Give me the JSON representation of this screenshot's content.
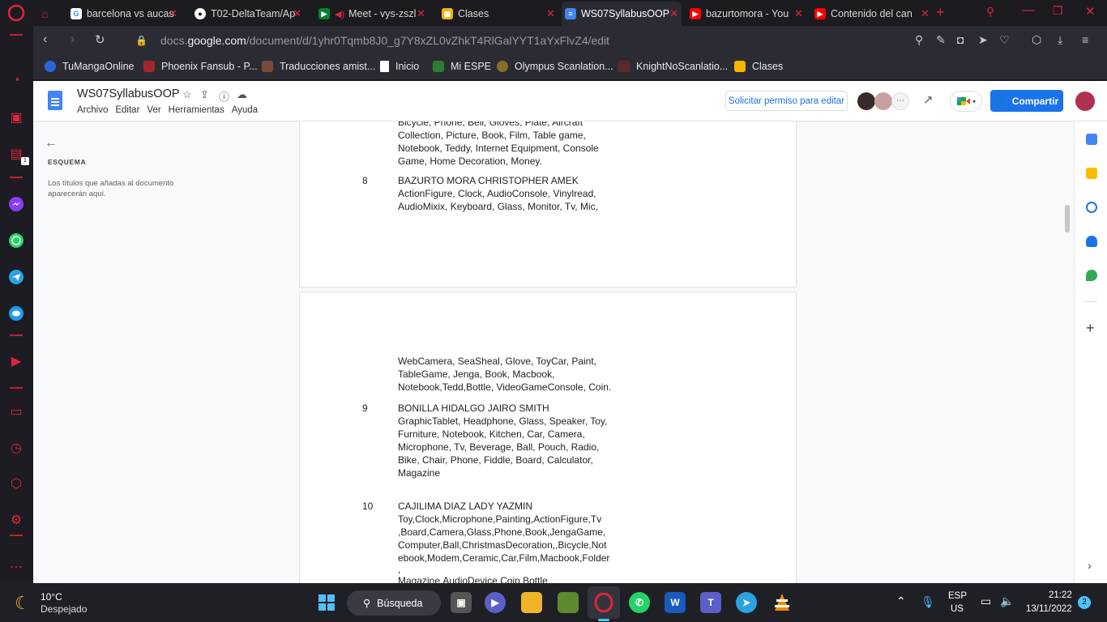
{
  "browser": {
    "tabs": [
      {
        "label": "barcelona vs aucas",
        "icon": "google-icon"
      },
      {
        "label": "T02-DeltaTeam/Ap",
        "icon": "github-icon"
      },
      {
        "label": "Meet - vys-zszl",
        "icon": "google-meet-icon"
      },
      {
        "label": "Clases",
        "icon": "classroom-icon"
      },
      {
        "label": "WS07SyllabusOOP",
        "icon": "google-docs-icon",
        "active": true
      },
      {
        "label": "bazurtomora - You",
        "icon": "youtube-icon"
      },
      {
        "label": "Contenido del can",
        "icon": "youtube-icon"
      }
    ],
    "url_prefix": "docs.",
    "url_domain": "google.com",
    "url_path": "/document/d/1yhr0Tqmb8J0_g7Y8xZL0vZhkT4RlGalYYT1aYxFlvZ4/edit",
    "bookmarks": [
      {
        "label": "TuMangaOnline"
      },
      {
        "label": "Phoenix Fansub - P..."
      },
      {
        "label": "Traducciones amist..."
      },
      {
        "label": "Inicio"
      },
      {
        "label": "Mi ESPE"
      },
      {
        "label": "Olympus Scanlation..."
      },
      {
        "label": "KnightNoScanlatio..."
      },
      {
        "label": "Clases"
      }
    ]
  },
  "docs": {
    "title": "WS07SyllabusOOP",
    "menu": [
      "Archivo",
      "Editar",
      "Ver",
      "Herramientas",
      "Ayuda"
    ],
    "request_edit_label": "Solicitar permiso para editar",
    "share_label": "Compartir"
  },
  "outline": {
    "title": "ESQUEMA",
    "hint": "Los títulos que añadas al documento aparecerán aquí."
  },
  "document": {
    "page1_top_text": "Bicycle, Phone, Bell, Gloves, Plate, Aircraft Collection, Picture, Book, Film, Table game, Notebook, Teddy, Internet Equipment, Console Game, Home Decoration, Money.",
    "entry8": {
      "num": "8",
      "name": "BAZURTO MORA CHRISTOPHER AMEK",
      "items": "ActionFigure, Clock, AudioConsole, Vinylread, AudioMixix, Keyboard, Glass, Monitor, Tv, Mic,"
    },
    "page2_continuation": "WebCamera, SeaSheal, Glove, ToyCar, Paint, TableGame, Jenga, Book, Macbook, Notebook,Tedd,Bottle, VideoGameConsole, Coin.",
    "entry9": {
      "num": "9",
      "name": "BONILLA HIDALGO JAIRO SMITH",
      "items": "GraphicTablet, Headphone, Glass, Speaker, Toy, Furniture, Notebook, Kitchen, Car, Camera, Microphone, Tv, Beverage, Ball, Pouch, Radio, Bike, Chair, Phone, Fiddle, Board, Calculator, Magazine"
    },
    "entry10": {
      "num": "10",
      "name": "CAJILIMA DIAZ LADY YAZMIN",
      "items_line1": "Toy,Clock,Microphone,Painting,ActionFigure,Tv",
      "items_line2": ",Board,Camera,Glass,Phone,Book,JengaGame,",
      "items_line3": "Computer,Ball,ChristmasDecoration,,Bicycle,Not",
      "items_line4": "ebook,Modem,Ceramic,Car,Film,Macbook,Folder",
      "items_line5": ",",
      "items_line6": "Magazine,AudioDevice,Coin,Bottle"
    }
  },
  "taskbar": {
    "weather_temp": "10°C",
    "weather_desc": "Despejado",
    "search_label": "Búsqueda",
    "lang": "ESP",
    "region": "US",
    "time": "21:22",
    "date": "13/11/2022",
    "notification_count": "2"
  },
  "sidebar_badge": "1"
}
